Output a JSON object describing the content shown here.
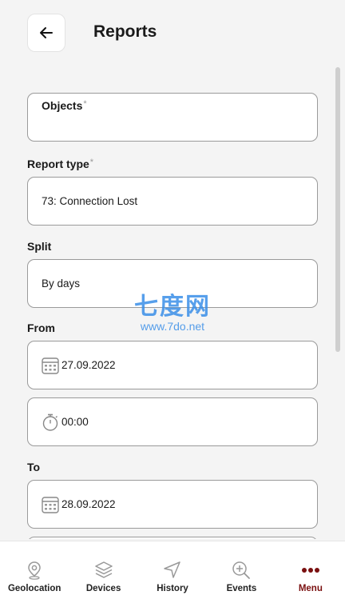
{
  "header": {
    "title": "Reports",
    "back_icon": "arrow-left-icon"
  },
  "form": {
    "objects": {
      "label": "Objects",
      "required": "*",
      "value": ""
    },
    "report_type": {
      "label": "Report type",
      "required": "*",
      "value": "73: Connection Lost"
    },
    "split": {
      "label": "Split",
      "value": "By days"
    },
    "from": {
      "label": "From",
      "date": "27.09.2022",
      "time": "00:00",
      "date_icon": "calendar-icon",
      "time_icon": "stopwatch-icon"
    },
    "to": {
      "label": "To",
      "date": "28.09.2022",
      "date_icon": "calendar-icon"
    }
  },
  "watermark": {
    "logo": "七度网",
    "url": "www.7do.net"
  },
  "bottom_nav": [
    {
      "label": "Geolocation",
      "icon": "map-pin-icon",
      "active": false
    },
    {
      "label": "Devices",
      "icon": "layers-icon",
      "active": false
    },
    {
      "label": "History",
      "icon": "navigation-arrow-icon",
      "active": false
    },
    {
      "label": "Events",
      "icon": "zoom-in-icon",
      "active": false
    },
    {
      "label": "Menu",
      "icon": "dots-menu-icon",
      "active": true
    }
  ],
  "colors": {
    "accent": "#7a1010",
    "background": "#f4f4f4",
    "field_border": "#9a9a9a",
    "watermark": "#3a8fe8"
  }
}
